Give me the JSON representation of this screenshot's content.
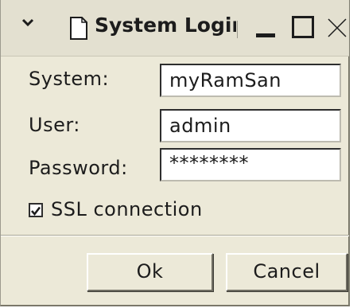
{
  "window": {
    "title": "System Login",
    "title_visible": "System Logir"
  },
  "form": {
    "system": {
      "label": "System:",
      "value": "myRamSan"
    },
    "user": {
      "label": "User:",
      "value": "admin"
    },
    "password": {
      "label": "Password:",
      "value": "********"
    },
    "ssl": {
      "label": "SSL connection",
      "checked": true
    }
  },
  "buttons": {
    "ok": "Ok",
    "cancel": "Cancel"
  },
  "icons": {
    "menu": "chevron-down-icon",
    "app": "document-icon",
    "minimize": "minimize-icon",
    "maximize": "maximize-icon",
    "close": "close-icon"
  }
}
